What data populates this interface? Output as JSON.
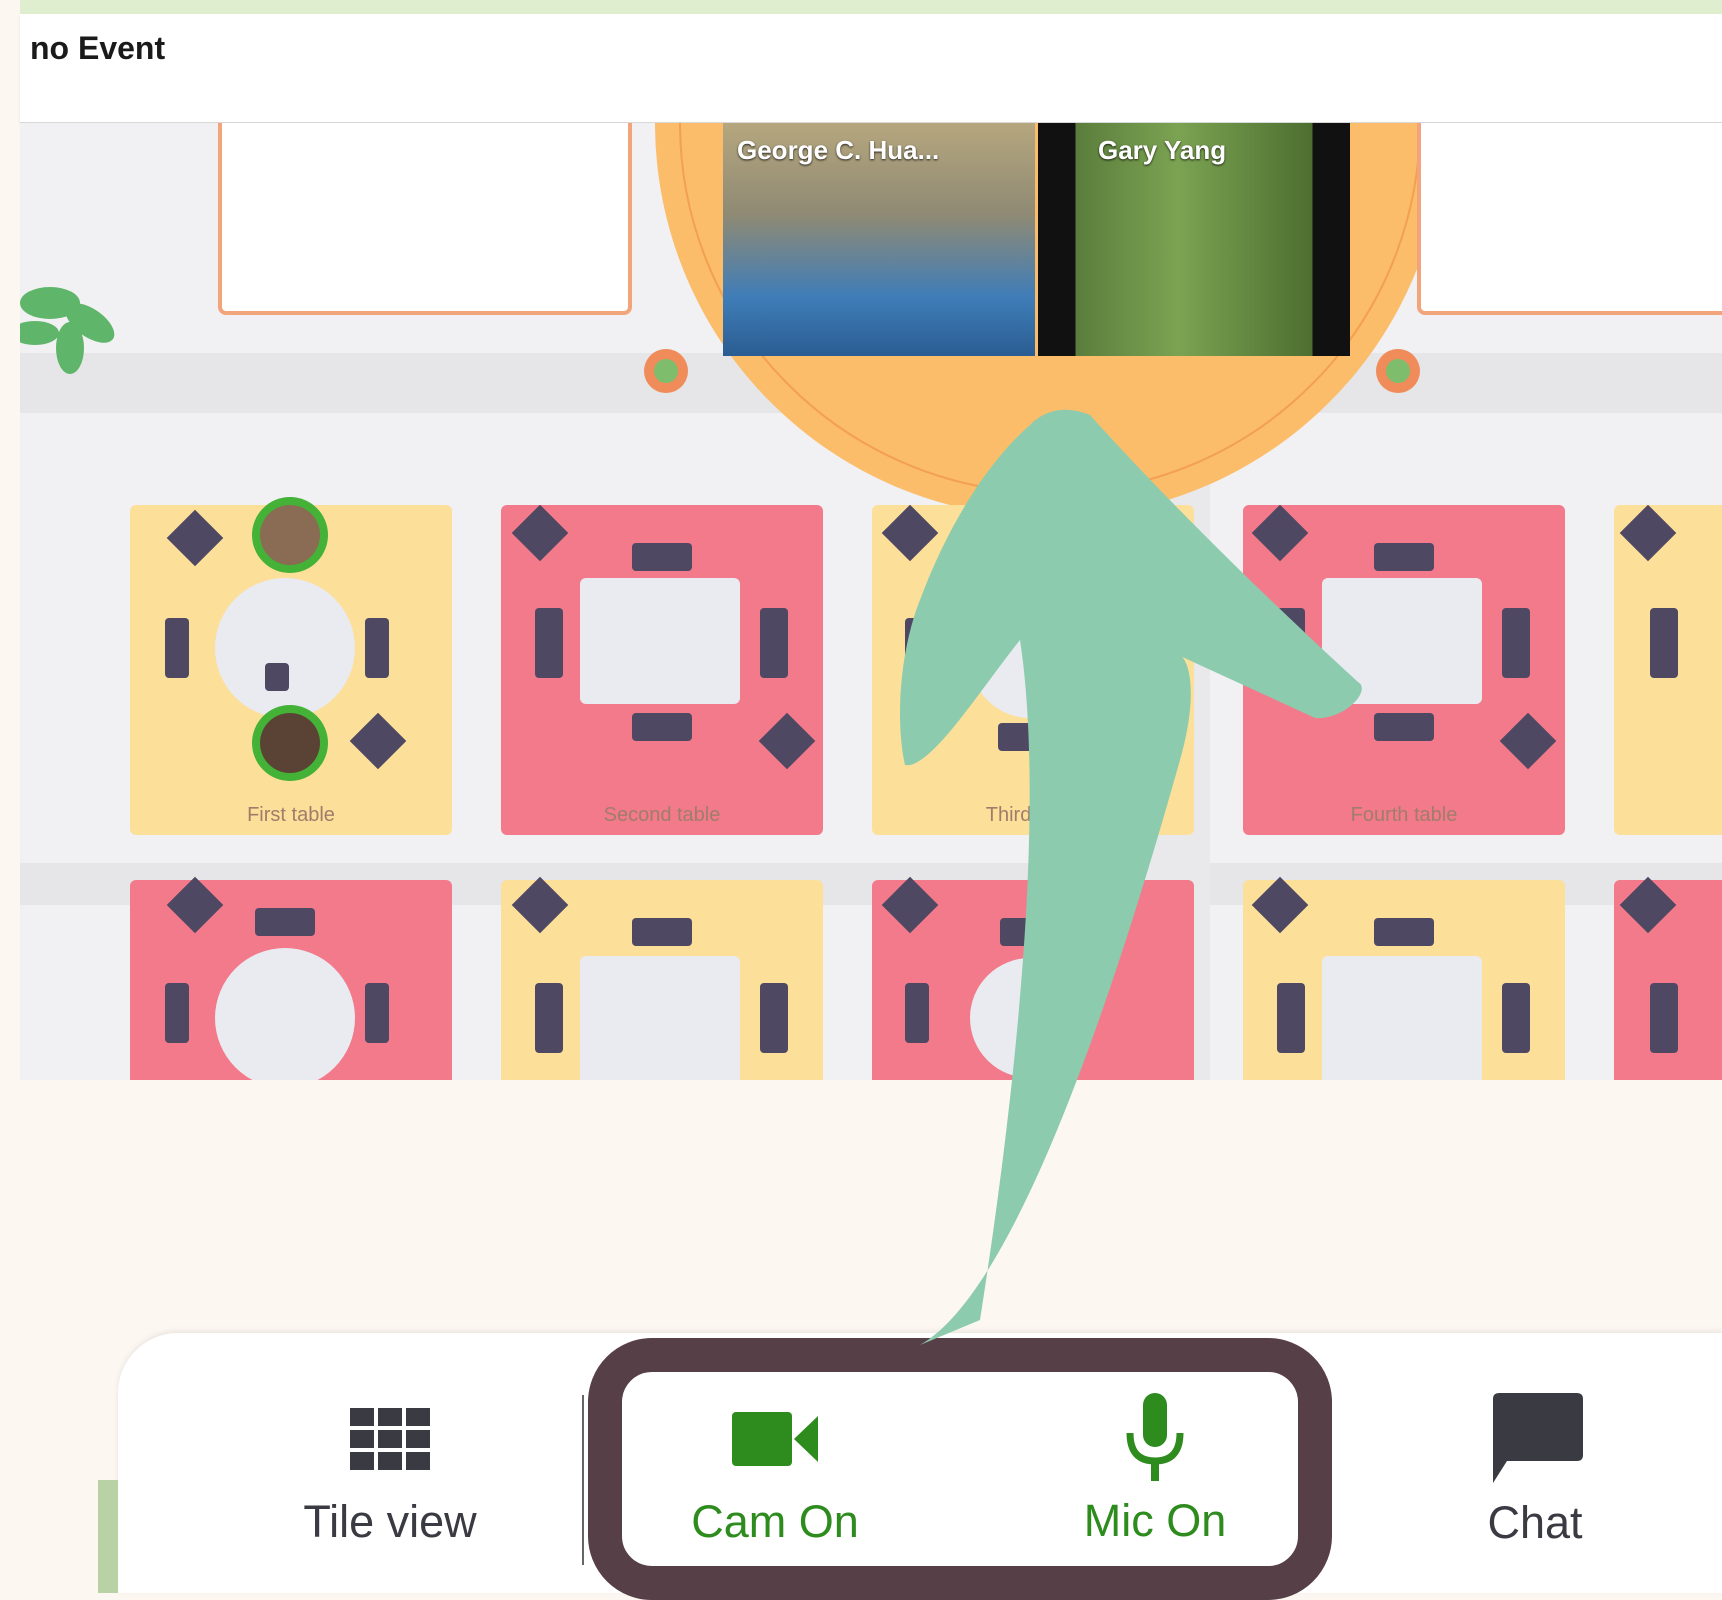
{
  "event": {
    "title": "no Event"
  },
  "videos": [
    {
      "name": "George C. Hua..."
    },
    {
      "name": "Gary Yang"
    }
  ],
  "tables": {
    "row1": [
      {
        "label": "First table"
      },
      {
        "label": "Second table"
      },
      {
        "label": "Third table"
      },
      {
        "label": "Fourth table"
      }
    ]
  },
  "toolbar": {
    "tile_view": {
      "label": "Tile view",
      "icon": "grid-icon"
    },
    "camera": {
      "label": "Cam On",
      "icon": "video-camera-icon"
    },
    "mic": {
      "label": "Mic On",
      "icon": "microphone-icon"
    },
    "chat": {
      "label": "Chat",
      "icon": "chat-bubble-icon"
    }
  },
  "colors": {
    "accent_green": "#2e8b1e",
    "arrow": "#8ccbae",
    "highlight": "#573f47",
    "table_yellow": "#fcdf98",
    "table_pink": "#f27a8a"
  }
}
